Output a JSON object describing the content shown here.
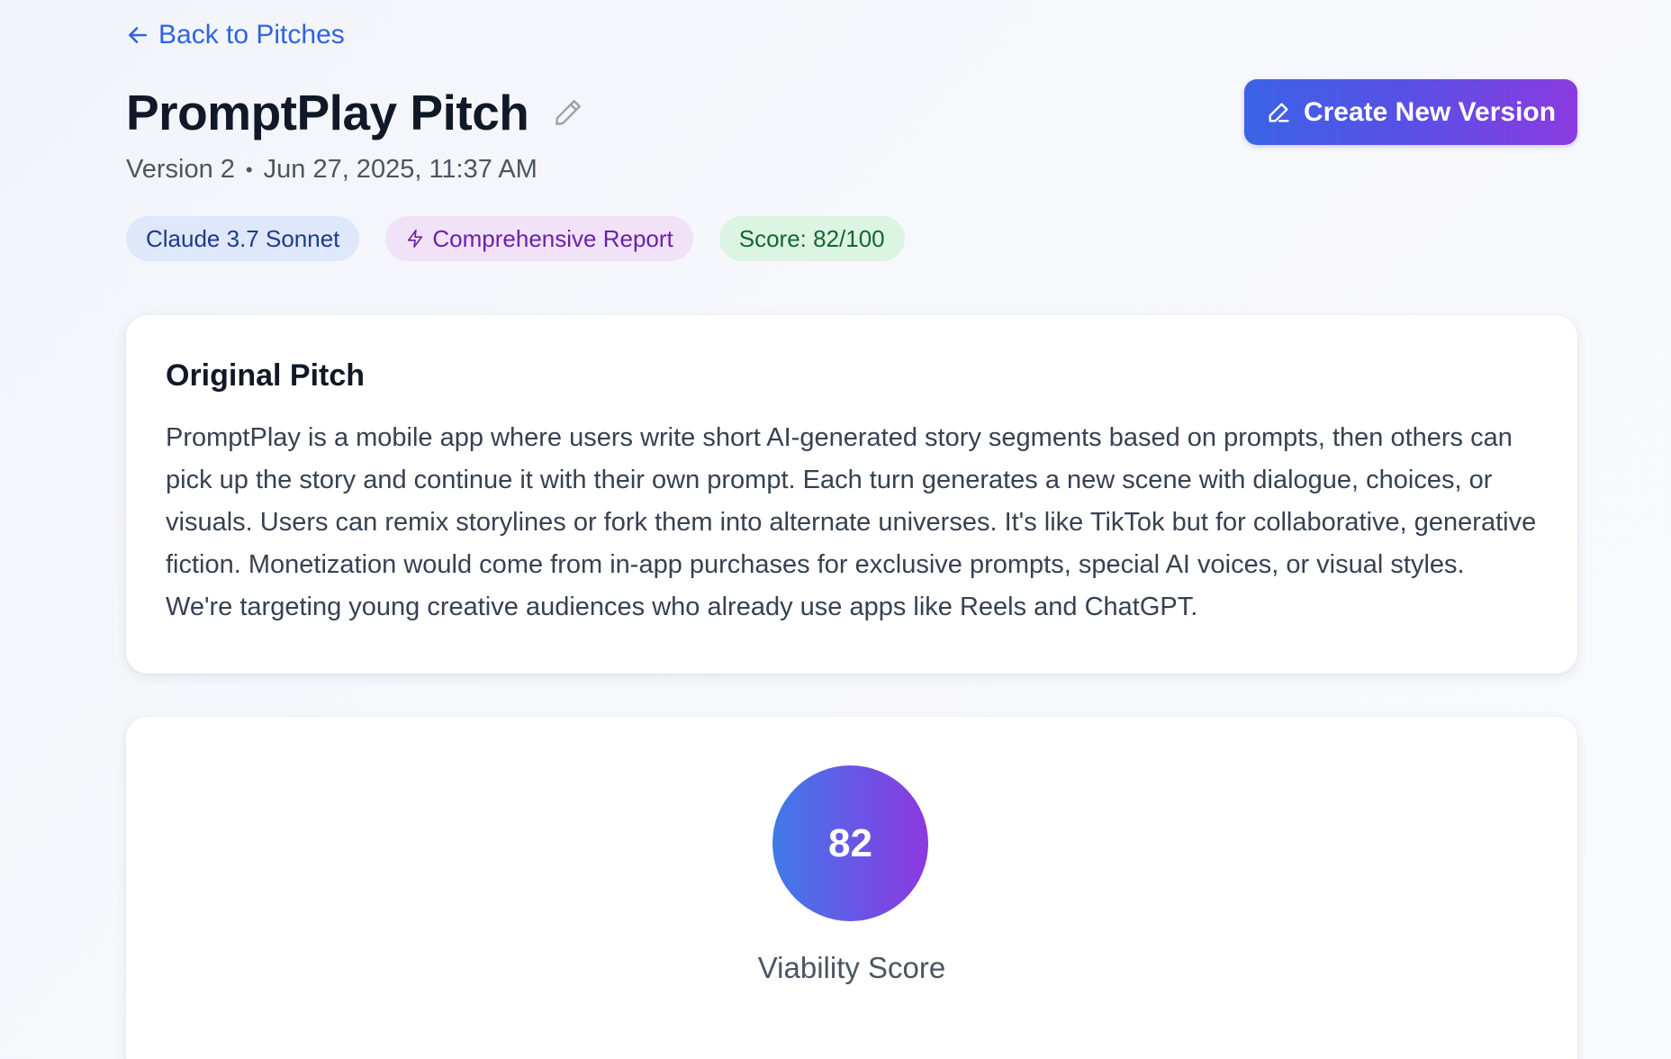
{
  "nav": {
    "back_label": "Back to Pitches"
  },
  "header": {
    "title": "PromptPlay Pitch",
    "version": "Version 2",
    "separator": "•",
    "timestamp": "Jun 27, 2025, 11:37 AM",
    "create_button_label": "Create New Version"
  },
  "badges": {
    "model": "Claude 3.7 Sonnet",
    "report": "Comprehensive Report",
    "score": "Score: 82/100"
  },
  "pitch": {
    "heading": "Original Pitch",
    "body": "PromptPlay is a mobile app where users write short AI-generated story segments based on prompts, then others can pick up the story and continue it with their own prompt. Each turn generates a new scene with dialogue, choices, or visuals. Users can remix storylines or fork them into alternate universes. It's like TikTok but for collaborative, generative fiction. Monetization would come from in-app purchases for exclusive prompts, special AI voices, or visual styles. We're targeting young creative audiences who already use apps like Reels and ChatGPT."
  },
  "viability": {
    "score": "82",
    "label": "Viability Score"
  },
  "icons": {
    "back": "arrow-left-icon",
    "edit_title": "pencil-icon",
    "create": "pen-icon",
    "report": "lightning-icon"
  },
  "colors": {
    "link": "#2f63e0",
    "button_gradient_start": "#3a63e6",
    "button_gradient_end": "#8a3be0",
    "badge_model_bg": "#dfe7fb",
    "badge_report_bg": "#f1e2f8",
    "badge_score_bg": "#dcf5e2"
  }
}
